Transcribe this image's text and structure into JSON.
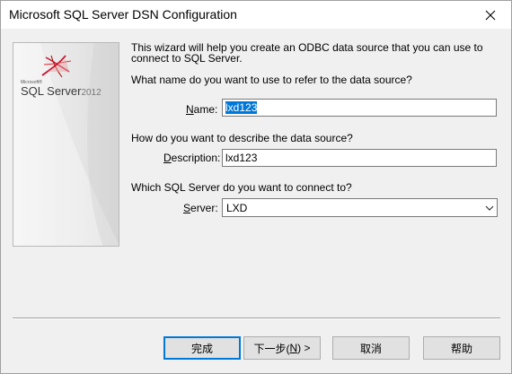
{
  "window": {
    "title": "Microsoft SQL Server DSN Configuration",
    "close_icon": "close-icon"
  },
  "side_panel": {
    "logo_small_text": "Microsoft®",
    "logo_product": "SQL Server",
    "logo_year": "2012"
  },
  "intro_text": "This wizard will help you create an ODBC data source that you can use to connect to SQL Server.",
  "name_question": "What name do you want to use to refer to the data source?",
  "name_label": {
    "underlined": "N",
    "rest": "ame:"
  },
  "name_value": "lxd123",
  "description_question": "How do you want to describe the data source?",
  "description_label": {
    "underlined": "D",
    "rest": "escription:"
  },
  "description_value": "lxd123",
  "server_question": "Which SQL Server do you want to connect to?",
  "server_label": {
    "underlined": "S",
    "rest": "erver:"
  },
  "server_value": "LXD",
  "buttons": {
    "finish": "完成",
    "next_prefix": "下一步(",
    "next_key": "N",
    "next_suffix": ") >",
    "cancel": "取消",
    "help": "帮助"
  }
}
